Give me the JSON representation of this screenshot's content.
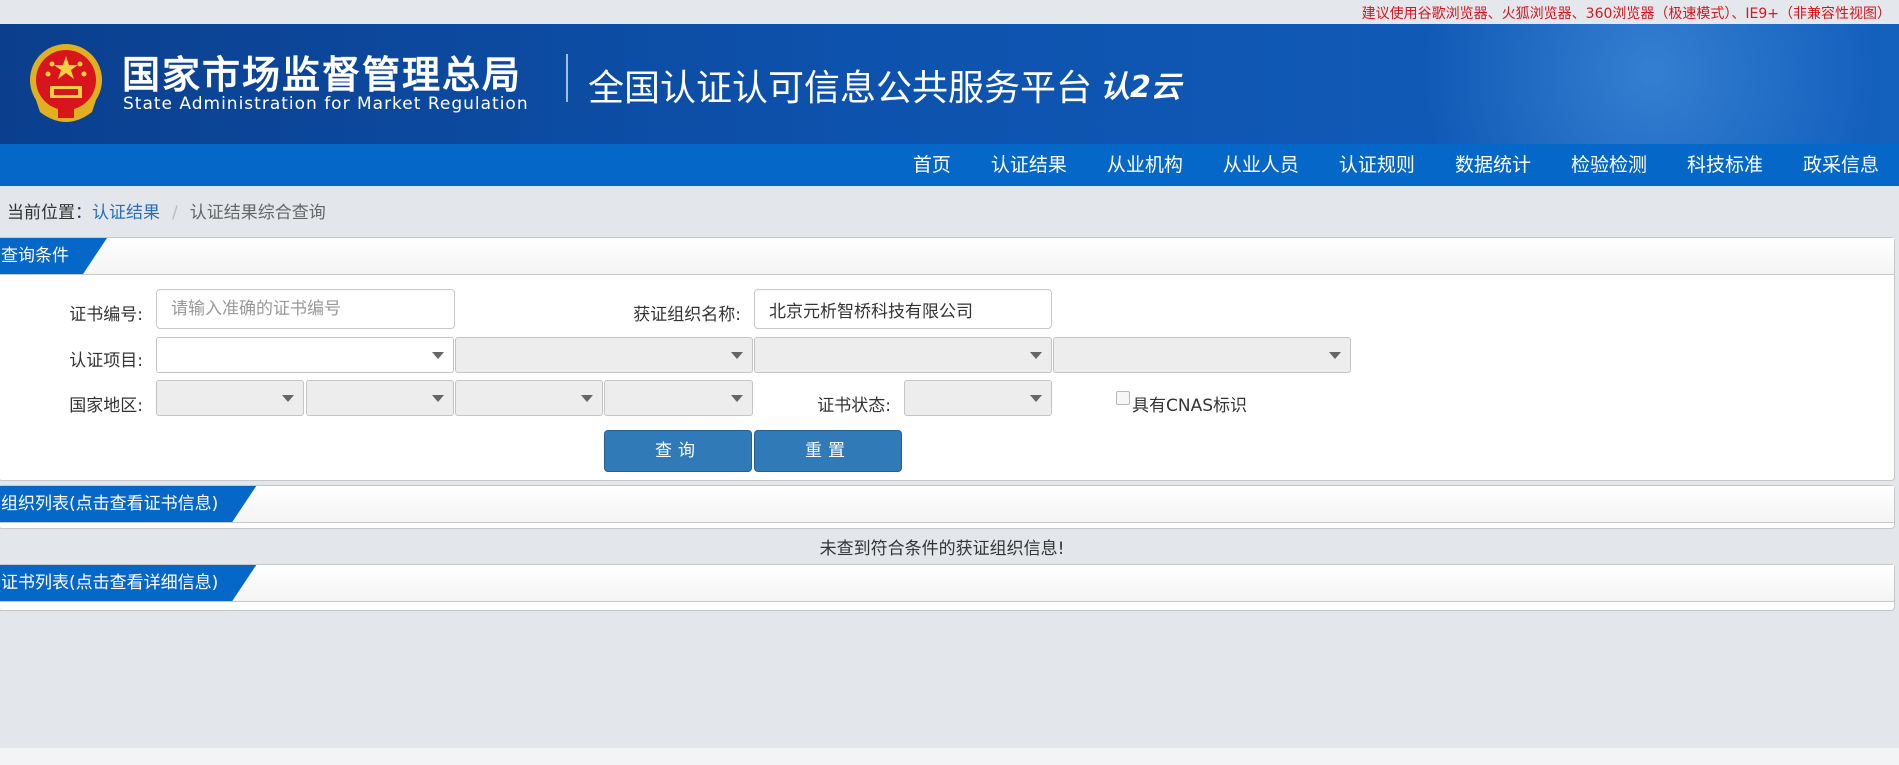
{
  "notice": "建议使用谷歌浏览器、火狐浏览器、360浏览器（极速模式）、IE9+（非兼容性视图）",
  "header": {
    "agency_cn": "国家市场监督管理总局",
    "agency_en": "State Administration  for  Market Regulation",
    "platform": "全国认证认可信息公共服务平台",
    "logo_text": "认2云"
  },
  "nav": {
    "items": [
      "首页",
      "认证结果",
      "从业机构",
      "从业人员",
      "认证规则",
      "数据统计",
      "检验检测",
      "科技标准",
      "政采信息"
    ]
  },
  "breadcrumb": {
    "prefix": "当前位置：",
    "link": "认证结果",
    "separator": "/",
    "current": "认证结果综合查询"
  },
  "query": {
    "title": "查询条件",
    "cert_no_label": "证书编号:",
    "cert_no_placeholder": "请输入准确的证书编号",
    "cert_no_value": "",
    "org_name_label": "获证组织名称:",
    "org_name_value": "北京元析智桥科技有限公司",
    "project_label": "认证项目:",
    "region_label": "国家地区:",
    "status_label": "证书状态:",
    "cnas_label": "具有CNAS标识",
    "search_button": "查询",
    "reset_button": "重置"
  },
  "org_list": {
    "title": "组织列表(点击查看证书信息)",
    "empty_message": "未查到符合条件的获证组织信息!"
  },
  "cert_list": {
    "title": "证书列表(点击查看详细信息)"
  },
  "colors": {
    "nav_blue": "#0567c8",
    "header_blue": "#0b3f8e",
    "button_blue": "#317ab8",
    "notice_red": "#d8141c",
    "link_blue": "#2a6db8"
  }
}
